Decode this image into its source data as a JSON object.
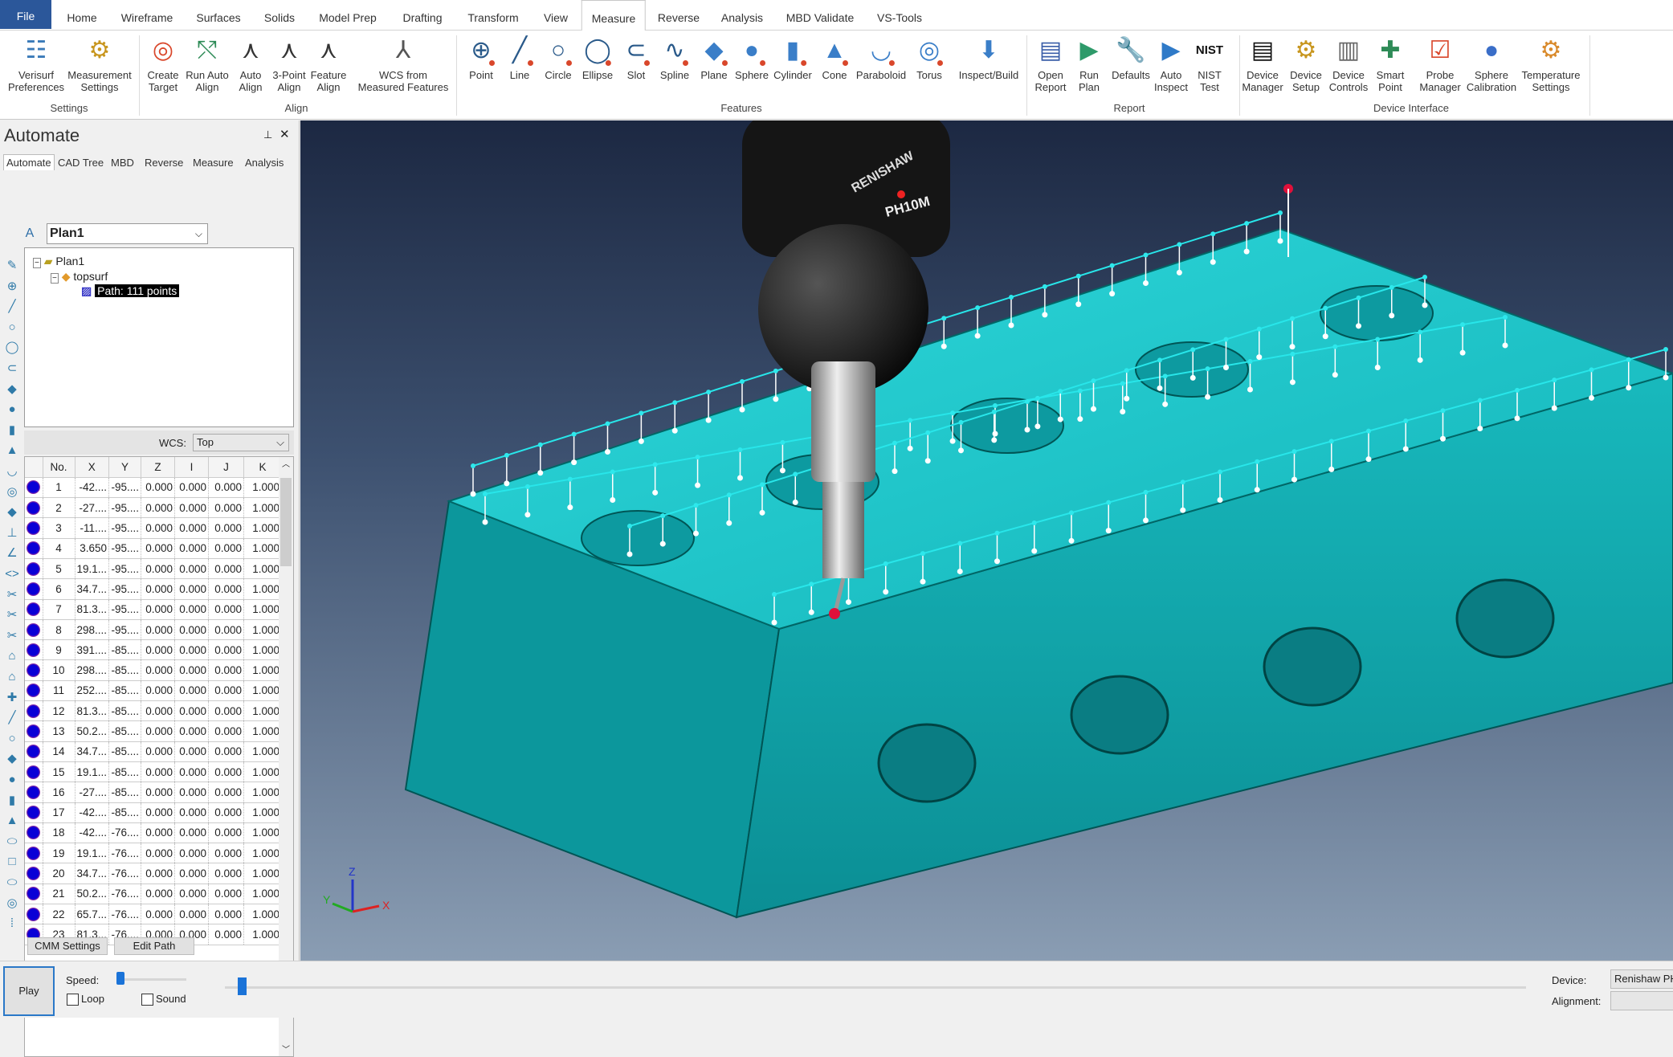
{
  "ribbon_tabs": [
    "File",
    "Home",
    "Wireframe",
    "Surfaces",
    "Solids",
    "Model Prep",
    "Drafting",
    "Transform",
    "View",
    "Measure",
    "Reverse",
    "Analysis",
    "MBD Validate",
    "VS-Tools"
  ],
  "active_ribbon_tab": "Measure",
  "ribbon_groups": {
    "settings": {
      "label": "Settings",
      "items": [
        {
          "l1": "Verisurf",
          "l2": "Preferences",
          "icon": "checklist-icon"
        },
        {
          "l1": "Measurement",
          "l2": "Settings",
          "icon": "probe-gear-icon"
        }
      ]
    },
    "align": {
      "label": "Align",
      "items": [
        {
          "l1": "Create",
          "l2": "Target",
          "icon": "target-icon"
        },
        {
          "l1": "Run Auto",
          "l2": "Align",
          "icon": "run-align-icon"
        },
        {
          "l1": "Auto",
          "l2": "Align",
          "icon": "auto-align-icon"
        },
        {
          "l1": "3-Point",
          "l2": "Align",
          "icon": "three-point-align-icon"
        },
        {
          "l1": "Feature",
          "l2": "Align",
          "icon": "feature-align-icon"
        },
        {
          "l1": "WCS from",
          "l2": "Measured Features",
          "icon": "wcs-icon"
        }
      ]
    },
    "features": {
      "label": "Features",
      "items": [
        {
          "l1": "Point",
          "icon": "point-icon"
        },
        {
          "l1": "Line",
          "icon": "line-icon"
        },
        {
          "l1": "Circle",
          "icon": "circle-icon"
        },
        {
          "l1": "Ellipse",
          "icon": "ellipse-icon"
        },
        {
          "l1": "Slot",
          "icon": "slot-icon"
        },
        {
          "l1": "Spline",
          "icon": "spline-icon"
        },
        {
          "l1": "Plane",
          "icon": "plane-icon"
        },
        {
          "l1": "Sphere",
          "icon": "sphere-icon"
        },
        {
          "l1": "Cylinder",
          "icon": "cylinder-icon"
        },
        {
          "l1": "Cone",
          "icon": "cone-icon"
        },
        {
          "l1": "Paraboloid",
          "icon": "paraboloid-icon"
        },
        {
          "l1": "Torus",
          "icon": "torus-icon"
        },
        {
          "l1": "Inspect/Build",
          "icon": "inspect-build-icon"
        }
      ]
    },
    "report": {
      "label": "Report",
      "items": [
        {
          "l1": "Open",
          "l2": "Report",
          "icon": "report-icon"
        },
        {
          "l1": "Run",
          "l2": "Plan",
          "icon": "run-plan-icon"
        },
        {
          "l1": "Defaults",
          "icon": "defaults-icon"
        },
        {
          "l1": "Auto",
          "l2": "Inspect",
          "icon": "play-icon"
        },
        {
          "l1": "NIST",
          "l2": "Test",
          "icon": "nist-icon"
        }
      ]
    },
    "device": {
      "label": "Device Interface",
      "items": [
        {
          "l1": "Device",
          "l2": "Manager",
          "icon": "device-manager-icon"
        },
        {
          "l1": "Device",
          "l2": "Setup",
          "icon": "gear-icon"
        },
        {
          "l1": "Device",
          "l2": "Controls",
          "icon": "controls-icon"
        },
        {
          "l1": "Smart",
          "l2": "Point",
          "icon": "smart-point-icon"
        },
        {
          "l1": "Probe",
          "l2": "Manager",
          "icon": "probe-manager-icon"
        },
        {
          "l1": "Sphere",
          "l2": "Calibration",
          "icon": "sphere-calibration-icon"
        },
        {
          "l1": "Temperature",
          "l2": "Settings",
          "icon": "temperature-icon"
        }
      ]
    }
  },
  "panel": {
    "title": "Automate",
    "tabs": [
      "Automate",
      "CAD Tree",
      "MBD",
      "Reverse",
      "Measure",
      "Analysis"
    ],
    "active_tab": "Automate",
    "plan_select": "Plan1",
    "tree": {
      "root": "Plan1",
      "child": "topsurf",
      "leaf": "Path: 111 points"
    },
    "wcs_label": "WCS:",
    "wcs_value": "Top",
    "columns": [
      "No.",
      "X",
      "Y",
      "Z",
      "I",
      "J",
      "K"
    ],
    "rows": [
      [
        "1",
        "-42....",
        "-95....",
        "0.000",
        "0.000",
        "0.000",
        "1.000"
      ],
      [
        "2",
        "-27....",
        "-95....",
        "0.000",
        "0.000",
        "0.000",
        "1.000"
      ],
      [
        "3",
        "-11....",
        "-95....",
        "0.000",
        "0.000",
        "0.000",
        "1.000"
      ],
      [
        "4",
        "3.650",
        "-95....",
        "0.000",
        "0.000",
        "0.000",
        "1.000"
      ],
      [
        "5",
        "19.1...",
        "-95....",
        "0.000",
        "0.000",
        "0.000",
        "1.000"
      ],
      [
        "6",
        "34.7...",
        "-95....",
        "0.000",
        "0.000",
        "0.000",
        "1.000"
      ],
      [
        "7",
        "81.3...",
        "-95....",
        "0.000",
        "0.000",
        "0.000",
        "1.000"
      ],
      [
        "8",
        "298....",
        "-95....",
        "0.000",
        "0.000",
        "0.000",
        "1.000"
      ],
      [
        "9",
        "391....",
        "-85....",
        "0.000",
        "0.000",
        "0.000",
        "1.000"
      ],
      [
        "10",
        "298....",
        "-85....",
        "0.000",
        "0.000",
        "0.000",
        "1.000"
      ],
      [
        "11",
        "252....",
        "-85....",
        "0.000",
        "0.000",
        "0.000",
        "1.000"
      ],
      [
        "12",
        "81.3...",
        "-85....",
        "0.000",
        "0.000",
        "0.000",
        "1.000"
      ],
      [
        "13",
        "50.2...",
        "-85....",
        "0.000",
        "0.000",
        "0.000",
        "1.000"
      ],
      [
        "14",
        "34.7...",
        "-85....",
        "0.000",
        "0.000",
        "0.000",
        "1.000"
      ],
      [
        "15",
        "19.1...",
        "-85....",
        "0.000",
        "0.000",
        "0.000",
        "1.000"
      ],
      [
        "16",
        "-27....",
        "-85....",
        "0.000",
        "0.000",
        "0.000",
        "1.000"
      ],
      [
        "17",
        "-42....",
        "-85....",
        "0.000",
        "0.000",
        "0.000",
        "1.000"
      ],
      [
        "18",
        "-42....",
        "-76....",
        "0.000",
        "0.000",
        "0.000",
        "1.000"
      ],
      [
        "19",
        "19.1...",
        "-76....",
        "0.000",
        "0.000",
        "0.000",
        "1.000"
      ],
      [
        "20",
        "34.7...",
        "-76....",
        "0.000",
        "0.000",
        "0.000",
        "1.000"
      ],
      [
        "21",
        "50.2...",
        "-76....",
        "0.000",
        "0.000",
        "0.000",
        "1.000"
      ],
      [
        "22",
        "65.7...",
        "-76....",
        "0.000",
        "0.000",
        "0.000",
        "1.000"
      ],
      [
        "23",
        "81.3...",
        "-76....",
        "0.000",
        "0.000",
        "0.000",
        "1.000"
      ]
    ],
    "cmm_settings": "CMM Settings",
    "edit_path": "Edit Path"
  },
  "viewport": {
    "probe_brand": "RENISHAW",
    "probe_model": "PH10M",
    "axis_x": "X",
    "axis_y": "Y",
    "axis_z": "Z",
    "part_color": "#1fc6c9"
  },
  "bottom": {
    "play": "Play",
    "speed_label": "Speed:",
    "speed_level": 0.05,
    "loop": "Loop",
    "loop_checked": false,
    "sound": "Sound",
    "sound_checked": false,
    "playback_position": 0.01,
    "device_label": "Device:",
    "device_value": "Renishaw PH",
    "alignment_label": "Alignment:",
    "alignment_value": ""
  }
}
